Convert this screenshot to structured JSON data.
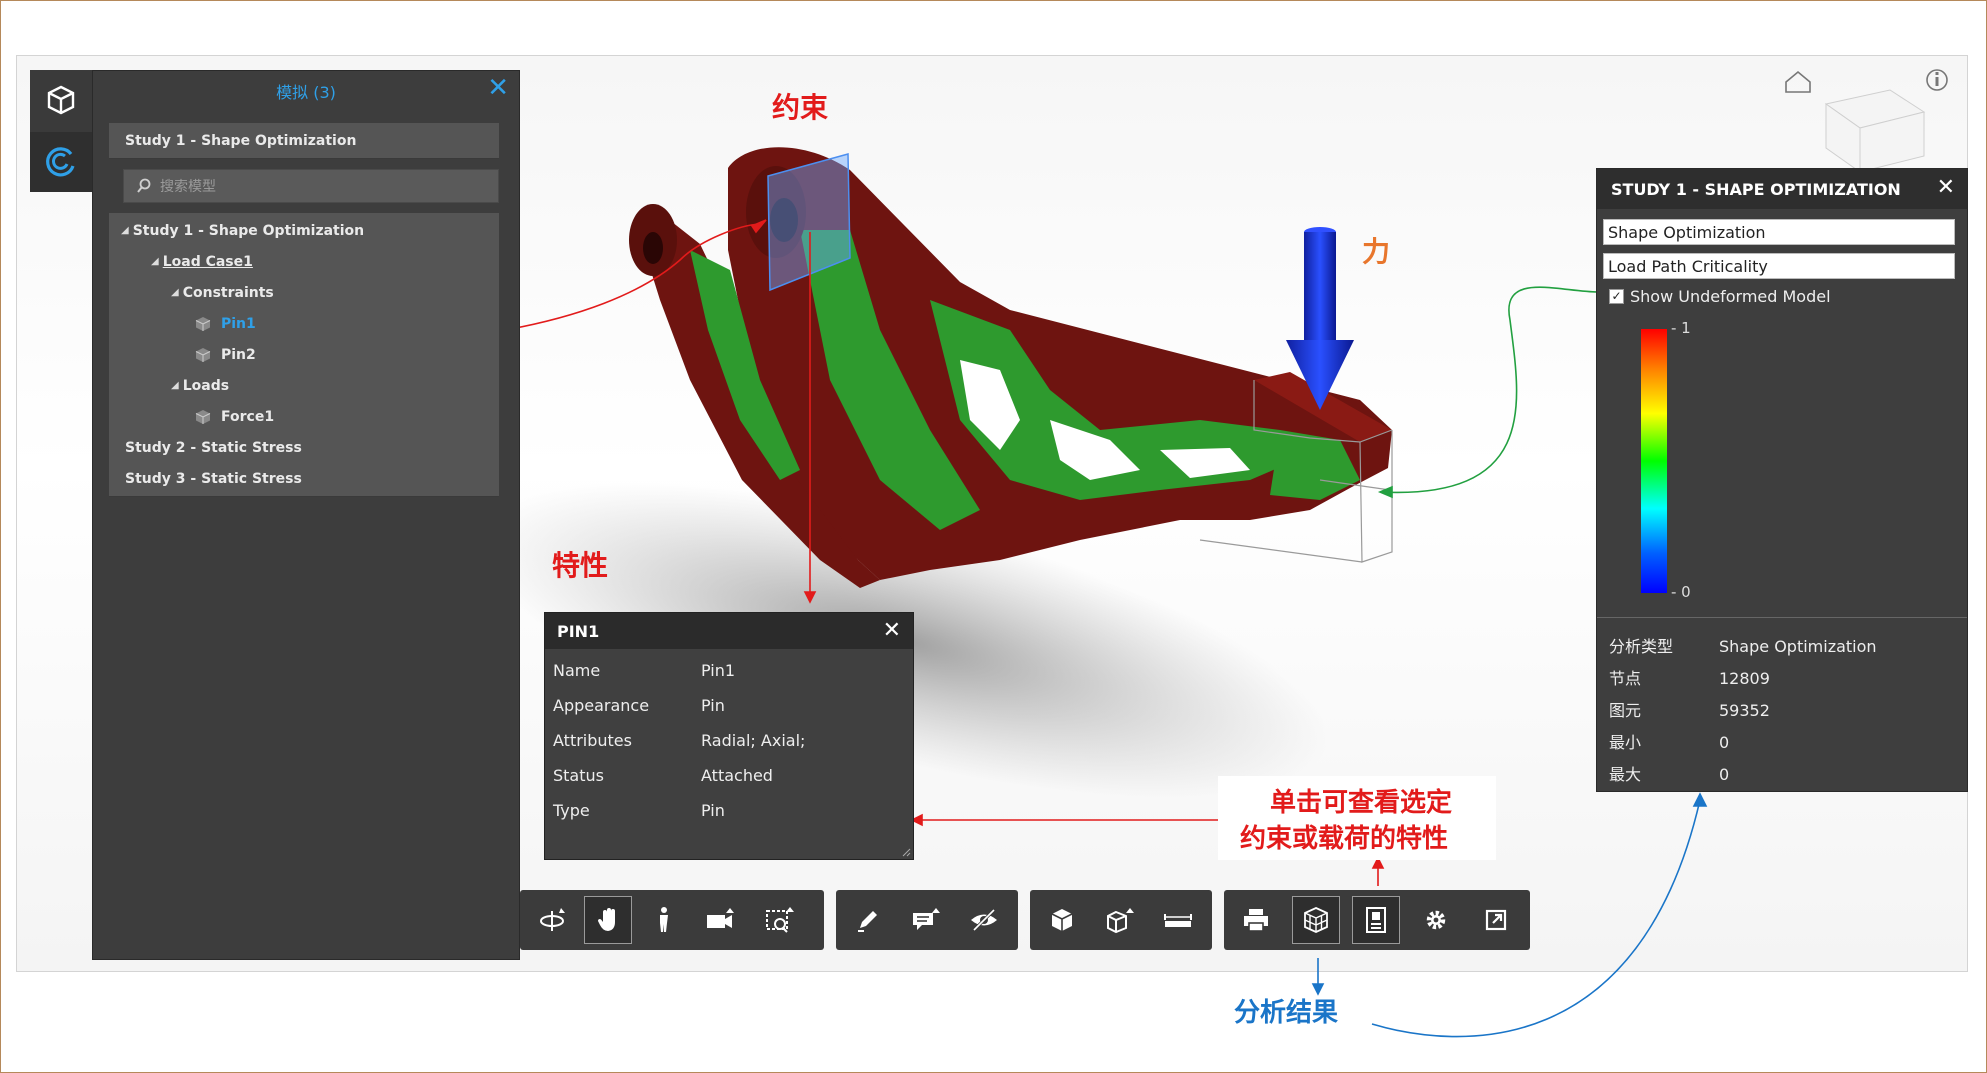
{
  "browser": {
    "title": "模拟 (3)",
    "close_label": "✕",
    "search_placeholder": "搜索模型",
    "items": [
      {
        "label": "Study 1 - Shape Optimization"
      },
      {
        "label": "Study 1 - Shape Optimization"
      },
      {
        "label": "Load Case1"
      },
      {
        "label": "Constraints"
      },
      {
        "label": "Pin1"
      },
      {
        "label": "Pin2"
      },
      {
        "label": "Loads"
      },
      {
        "label": "Force1"
      },
      {
        "label": "Study 2 - Static Stress"
      },
      {
        "label": "Study 3 - Static Stress"
      }
    ]
  },
  "results_panel": {
    "title": "STUDY 1 - SHAPE OPTIMIZATION",
    "close_label": "✕",
    "options": [
      "Shape Optimization",
      "Load Path Criticality"
    ],
    "checkbox_label": "Show Undeformed Model",
    "scale_max": "- 1",
    "scale_min": "- 0",
    "info": [
      {
        "key": "分析类型",
        "value": "Shape Optimization"
      },
      {
        "key": "节点",
        "value": "12809"
      },
      {
        "key": "图元",
        "value": "59352"
      },
      {
        "key": "最小",
        "value": "0"
      },
      {
        "key": "最大",
        "value": "0"
      }
    ]
  },
  "properties_panel": {
    "title": "PIN1",
    "close_label": "✕",
    "rows": [
      {
        "key": "Name",
        "value": "Pin1"
      },
      {
        "key": "Appearance",
        "value": "Pin"
      },
      {
        "key": "Attributes",
        "value": "Radial; Axial;"
      },
      {
        "key": "Status",
        "value": "Attached"
      },
      {
        "key": "Type",
        "value": "Pin"
      }
    ]
  },
  "annotations": {
    "constraint": "约束",
    "force": "力",
    "properties": "特性",
    "callout_line1": "单击可查看选定",
    "callout_line2": "约束或载荷的特性",
    "analysis_results": "分析结果"
  },
  "colors": {
    "accent_blue": "#2fa0e8",
    "annotation_red": "#e21b1b",
    "annotation_orange": "#e8762c",
    "annotation_blue": "#1a75c8",
    "part_dark_red": "#6e1410",
    "part_green": "#2e9a2e"
  }
}
